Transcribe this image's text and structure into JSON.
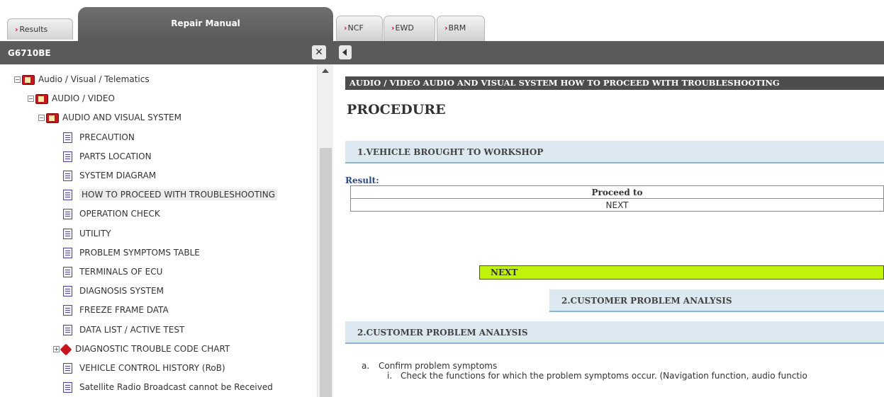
{
  "left_tabs": {
    "results": "Results",
    "repair_manual": "Repair Manual"
  },
  "left_header": {
    "title": "G6710BE",
    "close_icon": "✕"
  },
  "tree": [
    {
      "label": "Audio / Visual / Telematics",
      "icon": "book-icon",
      "expander": "⊟",
      "level": 0
    },
    {
      "label": "AUDIO / VIDEO",
      "icon": "book-icon",
      "expander": "⊟",
      "level": 1
    },
    {
      "label": "AUDIO AND VISUAL SYSTEM",
      "icon": "book-icon",
      "expander": "⊟",
      "level": 2
    },
    {
      "label": "PRECAUTION",
      "icon": "document-icon",
      "level": 3
    },
    {
      "label": "PARTS LOCATION",
      "icon": "document-icon",
      "level": 3
    },
    {
      "label": "SYSTEM DIAGRAM",
      "icon": "document-icon",
      "level": 3
    },
    {
      "label": "HOW TO PROCEED WITH TROUBLESHOOTING",
      "icon": "document-icon",
      "level": 3,
      "selected": true
    },
    {
      "label": "OPERATION CHECK",
      "icon": "document-icon",
      "level": 3
    },
    {
      "label": "UTILITY",
      "icon": "document-icon",
      "level": 3
    },
    {
      "label": "PROBLEM SYMPTOMS TABLE",
      "icon": "document-icon",
      "level": 3
    },
    {
      "label": "TERMINALS OF ECU",
      "icon": "document-icon",
      "level": 3
    },
    {
      "label": "DIAGNOSIS SYSTEM",
      "icon": "document-icon",
      "level": 3
    },
    {
      "label": "FREEZE FRAME DATA",
      "icon": "document-icon",
      "level": 3
    },
    {
      "label": "DATA LIST / ACTIVE TEST",
      "icon": "document-icon",
      "level": 3
    },
    {
      "label": "DIAGNOSTIC TROUBLE CODE CHART",
      "icon": "dtc-chart-icon",
      "expander": "⊞",
      "level": 3
    },
    {
      "label": "VEHICLE CONTROL HISTORY (RoB)",
      "icon": "document-icon",
      "level": 3
    },
    {
      "label": "Satellite Radio Broadcast cannot be Received",
      "icon": "document-icon",
      "level": 3
    }
  ],
  "right_tabs": [
    {
      "label": "NCF"
    },
    {
      "label": "EWD"
    },
    {
      "label": "BRM"
    }
  ],
  "content": {
    "breadcrumb": "AUDIO / VIDEO  AUDIO AND VISUAL SYSTEM  HOW TO PROCEED WITH TROUBLESHOOTING",
    "title": "PROCEDURE",
    "step1": "1.VEHICLE BROUGHT TO WORKSHOP",
    "result_label": "Result:",
    "table_header": "Proceed to",
    "table_value": "NEXT",
    "next_label": "NEXT",
    "step2_link": "2.CUSTOMER PROBLEM ANALYSIS",
    "step2": "2.CUSTOMER PROBLEM ANALYSIS",
    "list_a_marker": "a.",
    "list_a_text": "Confirm problem symptoms",
    "list_i_marker": "i.",
    "list_i_text": "Check the functions for which the problem symptoms occur. (Navigation function, audio functio"
  },
  "colors": {
    "header_dark": "#5a5a5a",
    "step_bar": "#dde9f1",
    "next_bar": "#bff40a",
    "tab_arrow": "#d0152a",
    "result_label": "#2a4b84"
  }
}
